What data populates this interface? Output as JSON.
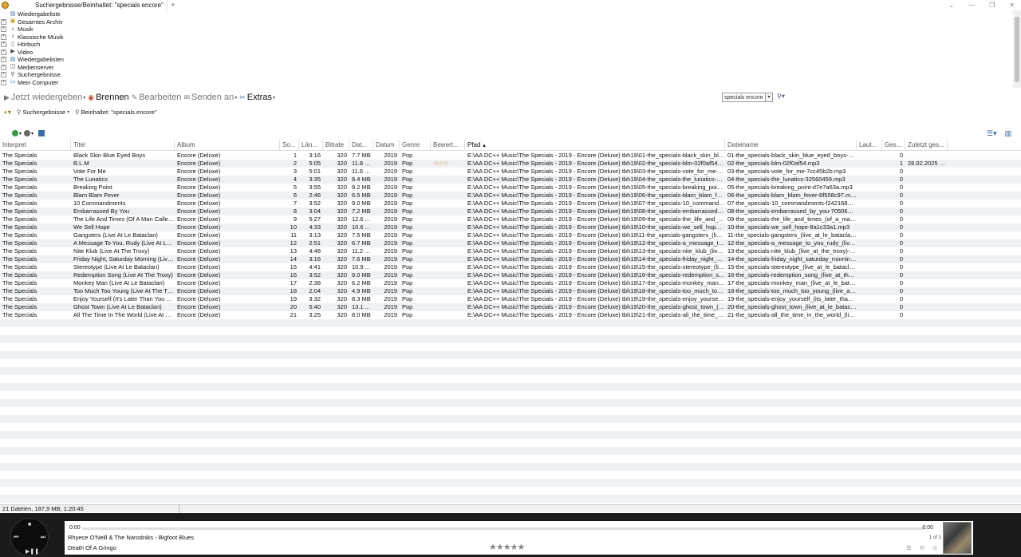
{
  "window": {
    "tab_label": "Suchergebnisse/Beinhaltet: \"specials encore\"",
    "tab_add": "+",
    "minimize": "⌄",
    "restore": "—",
    "maximize": "❐",
    "close": "✕"
  },
  "tree": [
    {
      "label": "Wiedergabeliste",
      "icon": "playlist-icon",
      "expandable": false
    },
    {
      "label": "Gesamtes Archiv",
      "icon": "archive-icon",
      "expandable": true
    },
    {
      "label": "Musik",
      "icon": "music-note-icon",
      "expandable": true
    },
    {
      "label": "Klassische Musik",
      "icon": "music-note-icon",
      "expandable": true
    },
    {
      "label": "Hörbuch",
      "icon": "book-icon",
      "expandable": true
    },
    {
      "label": "Video",
      "icon": "video-icon",
      "expandable": true
    },
    {
      "label": "Wiedergabelisten",
      "icon": "playlists-icon",
      "expandable": true
    },
    {
      "label": "Medienserver",
      "icon": "server-icon",
      "expandable": true
    },
    {
      "label": "Suchergebnisse",
      "icon": "search-icon",
      "expandable": true
    },
    {
      "label": "Mein Computer",
      "icon": "computer-icon",
      "expandable": true
    }
  ],
  "toolbar": {
    "play_now": "Jetzt wiedergeben",
    "burn": "Brennen",
    "edit": "Bearbeiten",
    "send_to": "Senden an",
    "extras": "Extras",
    "search_value": "specials encore"
  },
  "breadcrumb": {
    "search_results": "Suchergebnisse",
    "contains": "Beinhaltet: \"specials encore\""
  },
  "columns": [
    "Interpret",
    "Titel",
    "Album",
    "So...",
    "Län...",
    "Bitrate",
    "Dat...",
    "Datum",
    "Genre",
    "Bewert...",
    "Pfad",
    "Dateiname",
    "Laut...",
    "Ges...",
    "Zuletzt ges..."
  ],
  "rows": [
    {
      "artist": "The Specials",
      "title": "Black Skin Blue Eyed Boys",
      "album": "Encore (Deluxe)",
      "track": "1",
      "length": "3:16",
      "bitrate": "320",
      "size": "7.7 MB",
      "year": "2019",
      "genre": "Pop",
      "rating": "",
      "path": "E:\\AA DC++ Music\\The Specials - 2019 - Encore (Deluxe) tbh19\\01-the_specials-black_skin_blue_eye...",
      "file": "01-the_specials-black_skin_blue_eyed_boys-09ad...",
      "plays": "0",
      "last": ""
    },
    {
      "artist": "The Specials",
      "title": "B.L.M",
      "album": "Encore (Deluxe)",
      "track": "2",
      "length": "5:05",
      "bitrate": "320",
      "size": "11.8 ...",
      "year": "2019",
      "genre": "Pop",
      "rating": "☆☆☆",
      "path": "E:\\AA DC++ Music\\The Specials - 2019 - Encore (Deluxe) tbh19\\02-the_specials-blm-02f0af54.mp3",
      "file": "02-the_specials-blm-02f0af54.mp3",
      "plays": "1",
      "last": "28.02.2025 0..."
    },
    {
      "artist": "The Specials",
      "title": "Vote For Me",
      "album": "Encore (Deluxe)",
      "track": "3",
      "length": "5:01",
      "bitrate": "320",
      "size": "11.6 ...",
      "year": "2019",
      "genre": "Pop",
      "rating": "",
      "path": "E:\\AA DC++ Music\\The Specials - 2019 - Encore (Deluxe) tbh19\\03-the_specials-vote_for_me-7cc45b2b...",
      "file": "03-the_specials-vote_for_me-7cc45b2b.mp3",
      "plays": "0",
      "last": ""
    },
    {
      "artist": "The Specials",
      "title": "The Lunatics",
      "album": "Encore (Deluxe)",
      "track": "4",
      "length": "3:35",
      "bitrate": "320",
      "size": "8.4 MB",
      "year": "2019",
      "genre": "Pop",
      "rating": "",
      "path": "E:\\AA DC++ Music\\The Specials - 2019 - Encore (Deluxe) tbh19\\04-the_specials-the_lunatics-325604...",
      "file": "04-the_specials-the_lunatics-32560459.mp3",
      "plays": "0",
      "last": ""
    },
    {
      "artist": "The Specials",
      "title": "Breaking Point",
      "album": "Encore (Deluxe)",
      "track": "5",
      "length": "3:55",
      "bitrate": "320",
      "size": "9.2 MB",
      "year": "2019",
      "genre": "Pop",
      "rating": "",
      "path": "E:\\AA DC++ Music\\The Specials - 2019 - Encore (Deluxe) tbh19\\05-the_specials-breaking_point-d7e7a6...",
      "file": "05-the_specials-breaking_point-d7e7a63a.mp3",
      "plays": "0",
      "last": ""
    },
    {
      "artist": "The Specials",
      "title": "Blam Blam Fever",
      "album": "Encore (Deluxe)",
      "track": "6",
      "length": "2:46",
      "bitrate": "320",
      "size": "6.5 MB",
      "year": "2019",
      "genre": "Pop",
      "rating": "",
      "path": "E:\\AA DC++ Music\\The Specials - 2019 - Encore (Deluxe) tbh19\\06-the_specials-blam_blam_fever-8f5...",
      "file": "06-the_specials-blam_blam_fever-8f558c97.mp3",
      "plays": "0",
      "last": ""
    },
    {
      "artist": "The Specials",
      "title": "10 Commandments",
      "album": "Encore (Deluxe)",
      "track": "7",
      "length": "3:52",
      "bitrate": "320",
      "size": "9.0 MB",
      "year": "2019",
      "genre": "Pop",
      "rating": "",
      "path": "E:\\AA DC++ Music\\The Specials - 2019 - Encore (Deluxe) tbh19\\07-the_specials-10_commandments-...",
      "file": "07-the_specials-10_commandments-f2421689.m...",
      "plays": "0",
      "last": ""
    },
    {
      "artist": "The Specials",
      "title": "Embarrassed By You",
      "album": "Encore (Deluxe)",
      "track": "8",
      "length": "3:04",
      "bitrate": "320",
      "size": "7.2 MB",
      "year": "2019",
      "genre": "Pop",
      "rating": "",
      "path": "E:\\AA DC++ Music\\The Specials - 2019 - Encore (Deluxe) tbh19\\08-the_specials-embarrassed_by_yo...",
      "file": "08-the_specials-embarrassed_by_you-70506e75....",
      "plays": "0",
      "last": ""
    },
    {
      "artist": "The Specials",
      "title": "The Life And Times (Of A Man Called D...",
      "album": "Encore (Deluxe)",
      "track": "9",
      "length": "5:27",
      "bitrate": "320",
      "size": "12.6 ...",
      "year": "2019",
      "genre": "Pop",
      "rating": "",
      "path": "E:\\AA DC++ Music\\The Specials - 2019 - Encore (Deluxe) tbh19\\09-the_specials-the_life_and_times_(...",
      "file": "09-the_specials-the_life_and_times_(of_a_man_c...",
      "plays": "0",
      "last": ""
    },
    {
      "artist": "The Specials",
      "title": "We Sell Hope",
      "album": "Encore (Deluxe)",
      "track": "10",
      "length": "4:33",
      "bitrate": "320",
      "size": "10.6 ...",
      "year": "2019",
      "genre": "Pop",
      "rating": "",
      "path": "E:\\AA DC++ Music\\The Specials - 2019 - Encore (Deluxe) tbh19\\10-the_specials-we_sell_hope-8a1c33...",
      "file": "10-the_specials-we_sell_hope-8a1c33a1.mp3",
      "plays": "0",
      "last": ""
    },
    {
      "artist": "The Specials",
      "title": "Gangsters (Live At Le Bataclan)",
      "album": "Encore (Deluxe)",
      "track": "11",
      "length": "3:13",
      "bitrate": "320",
      "size": "7.5 MB",
      "year": "2019",
      "genre": "Pop",
      "rating": "",
      "path": "E:\\AA DC++ Music\\The Specials - 2019 - Encore (Deluxe) tbh19\\11-the_specials-gangsters_(live_at_le...",
      "file": "11-the_specials-gangsters_(live_at_le_bataclan)-3...",
      "plays": "0",
      "last": ""
    },
    {
      "artist": "The Specials",
      "title": "A Message To You, Rudy (Live At Le B...",
      "album": "Encore (Deluxe)",
      "track": "12",
      "length": "2:51",
      "bitrate": "320",
      "size": "6.7 MB",
      "year": "2019",
      "genre": "Pop",
      "rating": "",
      "path": "E:\\AA DC++ Music\\The Specials - 2019 - Encore (Deluxe) tbh19\\12-the_specials-a_message_to_you_...",
      "file": "12-the_specials-a_message_to_you_rudy_(live_a...",
      "plays": "0",
      "last": ""
    },
    {
      "artist": "The Specials",
      "title": "Nite Klub (Live At The Troxy)",
      "album": "Encore (Deluxe)",
      "track": "13",
      "length": "4:48",
      "bitrate": "320",
      "size": "11.2 ...",
      "year": "2019",
      "genre": "Pop",
      "rating": "",
      "path": "E:\\AA DC++ Music\\The Specials - 2019 - Encore (Deluxe) tbh19\\13-the_specials-nite_klub_(live_at_th...",
      "file": "13-the_specials-nite_klub_(live_at_the_troxy)-dd...",
      "plays": "0",
      "last": ""
    },
    {
      "artist": "The Specials",
      "title": "Friday Night, Saturday Morning (Live A...",
      "album": "Encore (Deluxe)",
      "track": "14",
      "length": "3:16",
      "bitrate": "320",
      "size": "7.6 MB",
      "year": "2019",
      "genre": "Pop",
      "rating": "",
      "path": "E:\\AA DC++ Music\\The Specials - 2019 - Encore (Deluxe) tbh19\\14-the_specials-friday_night_saturda...",
      "file": "14-the_specials-friday_night_saturday_morning_(...",
      "plays": "0",
      "last": ""
    },
    {
      "artist": "The Specials",
      "title": "Stereotype (Live At Le Bataclan)",
      "album": "Encore (Deluxe)",
      "track": "15",
      "length": "4:41",
      "bitrate": "320",
      "size": "10.9 ...",
      "year": "2019",
      "genre": "Pop",
      "rating": "",
      "path": "E:\\AA DC++ Music\\The Specials - 2019 - Encore (Deluxe) tbh19\\15-the_specials-stereotype_(live_at_l...",
      "file": "15-the_specials-stereotype_(live_at_le_bataclan)-...",
      "plays": "0",
      "last": ""
    },
    {
      "artist": "The Specials",
      "title": "Redemption Song (Live At The Troxy)",
      "album": "Encore (Deluxe)",
      "track": "16",
      "length": "3:52",
      "bitrate": "320",
      "size": "9.0 MB",
      "year": "2019",
      "genre": "Pop",
      "rating": "",
      "path": "E:\\AA DC++ Music\\The Specials - 2019 - Encore (Deluxe) tbh19\\16-the_specials-redemption_song_(li...",
      "file": "16-the_specials-redemption_song_(live_at_the_tr...",
      "plays": "0",
      "last": ""
    },
    {
      "artist": "The Specials",
      "title": "Monkey Man (Live At Le Bataclan)",
      "album": "Encore (Deluxe)",
      "track": "17",
      "length": "2:38",
      "bitrate": "320",
      "size": "6.2 MB",
      "year": "2019",
      "genre": "Pop",
      "rating": "",
      "path": "E:\\AA DC++ Music\\The Specials - 2019 - Encore (Deluxe) tbh19\\17-the_specials-monkey_man_(live_a...",
      "file": "17-the_specials-monkey_man_(live_at_le_bataclan...",
      "plays": "0",
      "last": ""
    },
    {
      "artist": "The Specials",
      "title": "Too Much Too Young (Live At The Tro...",
      "album": "Encore (Deluxe)",
      "track": "18",
      "length": "2:04",
      "bitrate": "320",
      "size": "4.9 MB",
      "year": "2019",
      "genre": "Pop",
      "rating": "",
      "path": "E:\\AA DC++ Music\\The Specials - 2019 - Encore (Deluxe) tbh19\\18-the_specials-too_much_too_you...",
      "file": "18-the_specials-too_much_too_young_(live_at_t...",
      "plays": "0",
      "last": ""
    },
    {
      "artist": "The Specials",
      "title": "Enjoy Yourself (It's Later Than You Thi...",
      "album": "Encore (Deluxe)",
      "track": "19",
      "length": "3:32",
      "bitrate": "320",
      "size": "8.3 MB",
      "year": "2019",
      "genre": "Pop",
      "rating": "",
      "path": "E:\\AA DC++ Music\\The Specials - 2019 - Encore (Deluxe) tbh19\\19-the_specials-enjoy_yourself_(its_l...",
      "file": "19-the_specials-enjoy_yourself_(its_later_than_y...",
      "plays": "0",
      "last": ""
    },
    {
      "artist": "The Specials",
      "title": "Ghost Town (Live At Le Bataclan)",
      "album": "Encore (Deluxe)",
      "track": "20",
      "length": "5:40",
      "bitrate": "320",
      "size": "13.1 ...",
      "year": "2019",
      "genre": "Pop",
      "rating": "",
      "path": "E:\\AA DC++ Music\\The Specials - 2019 - Encore (Deluxe) tbh19\\20-the_specials-ghost_town_(live_at...",
      "file": "20-the_specials-ghost_town_(live_at_le_bataclan)...",
      "plays": "0",
      "last": ""
    },
    {
      "artist": "The Specials",
      "title": "All The Time In The World (Live At The...",
      "album": "Encore (Deluxe)",
      "track": "21",
      "length": "3:25",
      "bitrate": "320",
      "size": "8.0 MB",
      "year": "2019",
      "genre": "Pop",
      "rating": "",
      "path": "E:\\AA DC++ Music\\The Specials - 2019 - Encore (Deluxe) tbh19\\21-the_specials-all_the_time_in_the_...",
      "file": "21-the_specials-all_the_time_in_the_world_(live_a...",
      "plays": "0",
      "last": ""
    }
  ],
  "status": "21 Dateien, 187,9 MB, 1:20:45",
  "player": {
    "time_elapsed": "0:00",
    "time_total": "0:00",
    "artist_album": "Rhyece O'Neill & The Narodniks - Bigfoot Blues",
    "track_title": "Death Of A Gringo",
    "queue_position": "1 of 1",
    "rating_stars": "★★★★★",
    "controls": "☰ ⟲ ⤨"
  }
}
